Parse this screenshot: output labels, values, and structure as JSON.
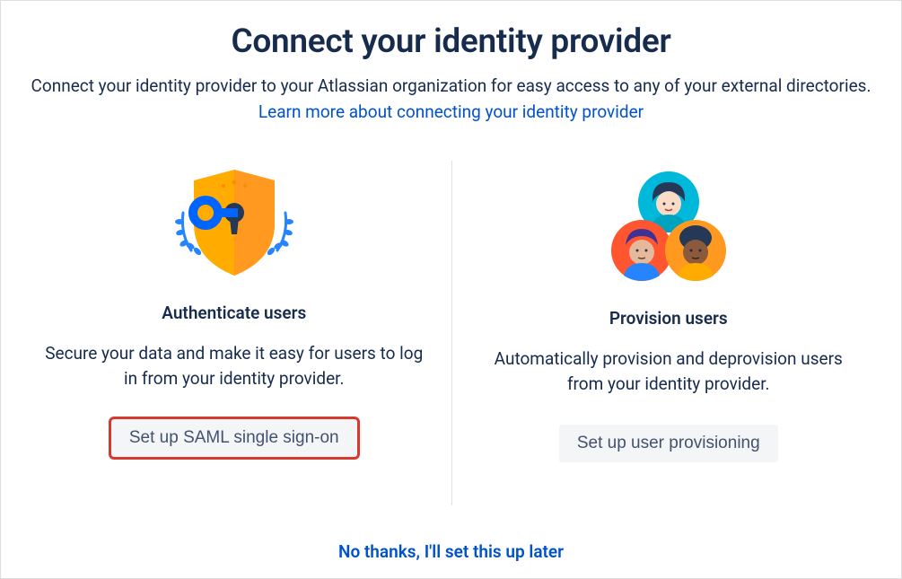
{
  "header": {
    "title": "Connect your identity provider",
    "description_part1": "Connect your identity provider to your Atlassian organization for easy access to any of your external directories. ",
    "link_text": "Learn more about connecting your identity provider"
  },
  "cards": {
    "authenticate": {
      "title": "Authenticate users",
      "description": "Secure your data and make it easy for users to log in from your identity provider.",
      "button_label": "Set up SAML single sign-on"
    },
    "provision": {
      "title": "Provision users",
      "description": "Automatically provision and deprovision users from your identity provider.",
      "button_label": "Set up user provisioning"
    }
  },
  "footer": {
    "skip_label": "No thanks, I'll set this up later"
  }
}
